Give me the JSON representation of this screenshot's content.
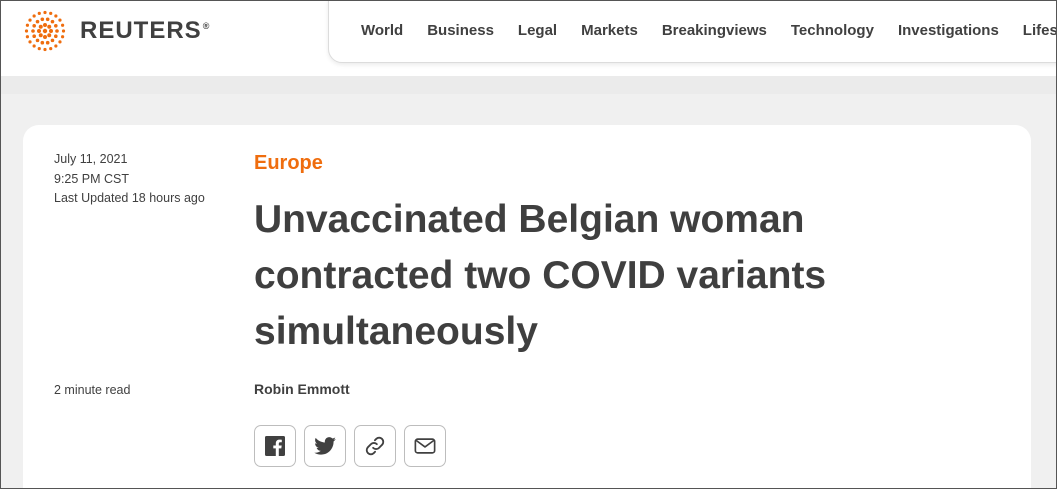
{
  "brand": {
    "name": "REUTERS",
    "registered": "®",
    "logo_color": "#ef6d0e"
  },
  "nav": {
    "items": [
      "World",
      "Business",
      "Legal",
      "Markets",
      "Breakingviews",
      "Technology",
      "Investigations",
      "Lifestyle"
    ]
  },
  "article": {
    "date": "July 11, 2021",
    "time": "9:25 PM CST",
    "updated": "Last Updated 18 hours ago",
    "section": "Europe",
    "headline": "Unvaccinated Belgian woman contracted two COVID variants simultaneously",
    "read_time": "2 minute read",
    "author": "Robin Emmott"
  },
  "share": {
    "buttons": [
      {
        "icon": "facebook-icon"
      },
      {
        "icon": "twitter-icon"
      },
      {
        "icon": "link-icon"
      },
      {
        "icon": "email-icon"
      }
    ]
  },
  "colors": {
    "accent": "#ef6d0e",
    "text": "#404040"
  }
}
